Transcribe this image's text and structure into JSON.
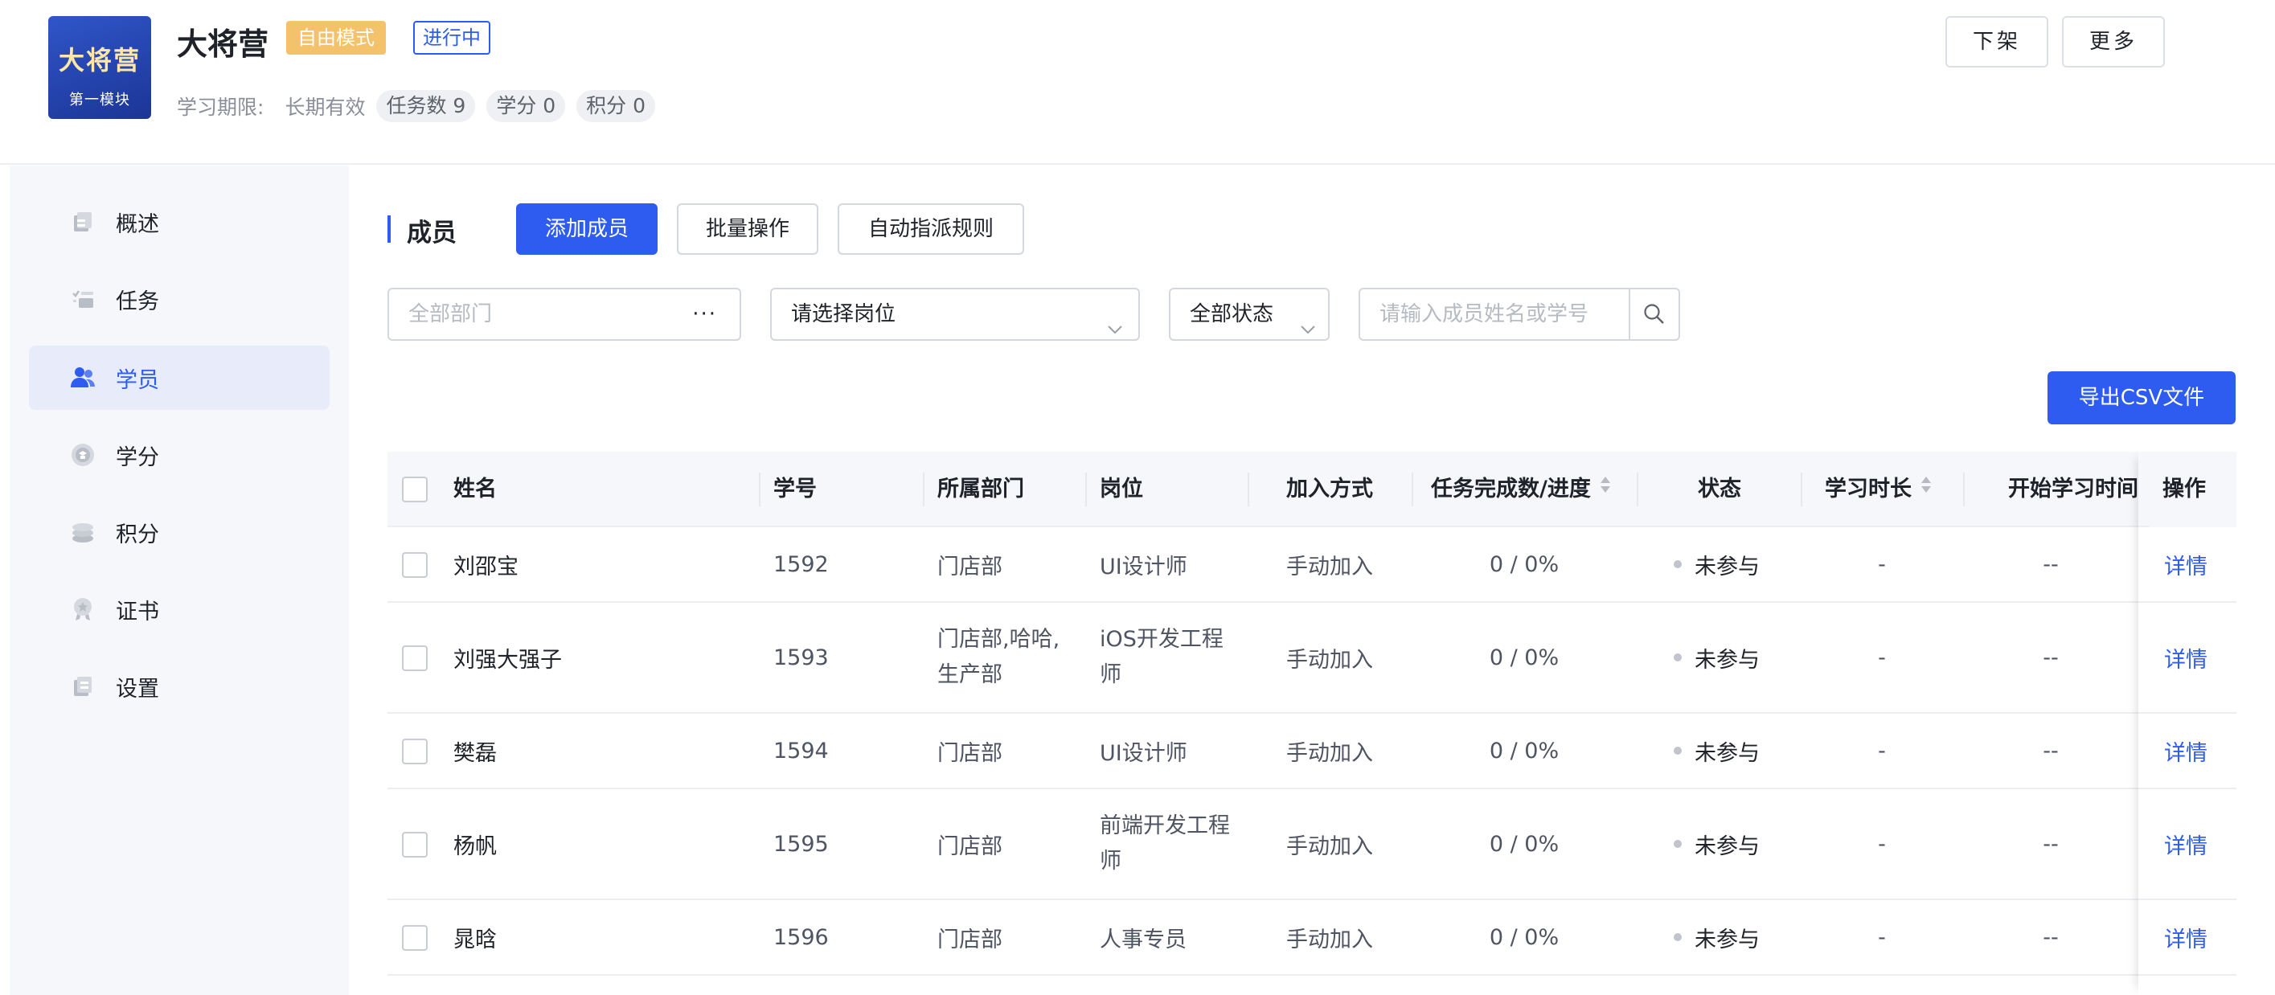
{
  "course": {
    "cover_title": "大将营",
    "cover_subtitle": "第一模块",
    "title": "大将营",
    "mode_tag": "自由模式",
    "status_tag": "进行中",
    "period_label": "学习期限:",
    "period_value": "长期有效",
    "task_count": "任务数 9",
    "credit": "学分 0",
    "points": "积分 0",
    "btn_off_shelf": "下架",
    "btn_more": "更多"
  },
  "sidebar": {
    "items": [
      {
        "label": "概述",
        "icon": "overview-icon"
      },
      {
        "label": "任务",
        "icon": "task-list-icon"
      },
      {
        "label": "学员",
        "icon": "users-icon",
        "active": true
      },
      {
        "label": "学分",
        "icon": "credit-icon"
      },
      {
        "label": "积分",
        "icon": "coins-icon"
      },
      {
        "label": "证书",
        "icon": "certificate-icon"
      },
      {
        "label": "设置",
        "icon": "settings-icon"
      }
    ]
  },
  "members": {
    "section_title": "成员",
    "btn_add": "添加成员",
    "btn_batch": "批量操作",
    "btn_auto_assign": "自动指派规则",
    "filter_department_placeholder": "全部部门",
    "filter_department_more": "···",
    "filter_position": "请选择岗位",
    "filter_status": "全部状态",
    "search_placeholder": "请输入成员姓名或学号",
    "btn_export": "导出CSV文件"
  },
  "table": {
    "columns": [
      "姓名",
      "学号",
      "所属部门",
      "岗位",
      "加入方式",
      "任务完成数/进度",
      "状态",
      "学习时长",
      "开始学习时间",
      "操作"
    ],
    "rows": [
      {
        "name": "刘邵宝",
        "id": "1592",
        "dept": "门店部",
        "position": "UI设计师",
        "join": "手动加入",
        "progress": "0 / 0%",
        "status": "未参与",
        "duration": "-",
        "start": "--",
        "action": "详情"
      },
      {
        "name": "刘强大强子",
        "id": "1593",
        "dept": "门店部,哈哈,生产部",
        "dept_l1": "门店部,哈哈,",
        "dept_l2": "生产部",
        "position": "iOS开发工程师",
        "position_l1": "iOS开发工程",
        "position_l2": "师",
        "join": "手动加入",
        "progress": "0 / 0%",
        "status": "未参与",
        "duration": "-",
        "start": "--",
        "action": "详情"
      },
      {
        "name": "樊磊",
        "id": "1594",
        "dept": "门店部",
        "position": "UI设计师",
        "join": "手动加入",
        "progress": "0 / 0%",
        "status": "未参与",
        "duration": "-",
        "start": "--",
        "action": "详情"
      },
      {
        "name": "杨帆",
        "id": "1595",
        "dept": "门店部",
        "position": "前端开发工程师",
        "position_l1": "前端开发工程",
        "position_l2": "师",
        "join": "手动加入",
        "progress": "0 / 0%",
        "status": "未参与",
        "duration": "-",
        "start": "--",
        "action": "详情"
      },
      {
        "name": "晁晗",
        "id": "1596",
        "dept": "门店部",
        "position": "人事专员",
        "join": "手动加入",
        "progress": "0 / 0%",
        "status": "未参与",
        "duration": "-",
        "start": "--",
        "action": "详情"
      }
    ]
  },
  "colors": {
    "primary": "#2e5bf0",
    "mode_tag": "#f3c26b",
    "sidebar_bg": "#f6f7fa",
    "sidebar_active_bg": "#e8ecfa"
  }
}
